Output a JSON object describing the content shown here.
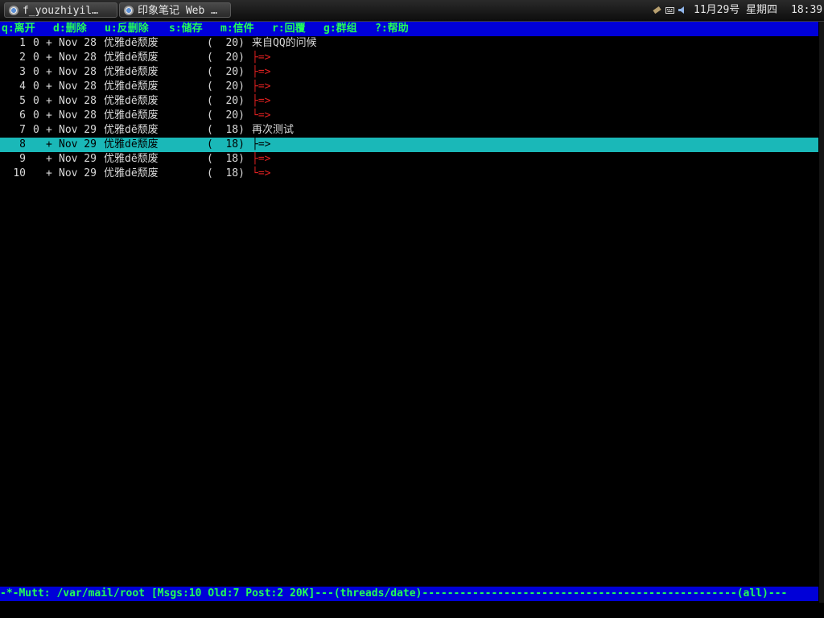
{
  "taskbar": {
    "tasks": [
      {
        "label": "f_youzhiyil…"
      },
      {
        "label": "印象笔记 Web …"
      }
    ],
    "date": "11月29号",
    "weekday": "星期四",
    "time": "18:39",
    "icons": [
      "network-icon",
      "keyboard-icon",
      "volume-icon"
    ]
  },
  "help": [
    {
      "key": "q:",
      "label": "离开"
    },
    {
      "key": "d:",
      "label": "删除"
    },
    {
      "key": "u:",
      "label": "反删除"
    },
    {
      "key": "s:",
      "label": "储存"
    },
    {
      "key": "m:",
      "label": "信件"
    },
    {
      "key": "r:",
      "label": "回覆"
    },
    {
      "key": "g:",
      "label": "群组"
    },
    {
      "key": "?:",
      "label": "帮助"
    }
  ],
  "messages": [
    {
      "num": "1",
      "flag": "0",
      "status": "+",
      "date": "Nov 28",
      "from": "优雅dē颓废",
      "size": "(  20)",
      "tree": "",
      "subject": "来自QQ的问候",
      "selected": false
    },
    {
      "num": "2",
      "flag": "0",
      "status": "+",
      "date": "Nov 28",
      "from": "优雅dē颓废",
      "size": "(  20)",
      "tree": "├=>",
      "subject": "",
      "selected": false
    },
    {
      "num": "3",
      "flag": "0",
      "status": "+",
      "date": "Nov 28",
      "from": "优雅dē颓废",
      "size": "(  20)",
      "tree": "├=>",
      "subject": "",
      "selected": false
    },
    {
      "num": "4",
      "flag": "0",
      "status": "+",
      "date": "Nov 28",
      "from": "优雅dē颓废",
      "size": "(  20)",
      "tree": "├=>",
      "subject": "",
      "selected": false
    },
    {
      "num": "5",
      "flag": "0",
      "status": "+",
      "date": "Nov 28",
      "from": "优雅dē颓废",
      "size": "(  20)",
      "tree": "├=>",
      "subject": "",
      "selected": false
    },
    {
      "num": "6",
      "flag": "0",
      "status": "+",
      "date": "Nov 28",
      "from": "优雅dē颓废",
      "size": "(  20)",
      "tree": "└=>",
      "subject": "",
      "selected": false
    },
    {
      "num": "7",
      "flag": "0",
      "status": "+",
      "date": "Nov 29",
      "from": "优雅dē颓废",
      "size": "(  18)",
      "tree": "",
      "subject": "再次测试",
      "selected": false
    },
    {
      "num": "8",
      "flag": "",
      "status": "+",
      "date": "Nov 29",
      "from": "优雅dē颓废",
      "size": "(  18)",
      "tree": "├=>",
      "subject": "",
      "selected": true
    },
    {
      "num": "9",
      "flag": "",
      "status": "+",
      "date": "Nov 29",
      "from": "优雅dē颓废",
      "size": "(  18)",
      "tree": "├=>",
      "subject": "",
      "selected": false
    },
    {
      "num": "10",
      "flag": "",
      "status": "+",
      "date": "Nov 29",
      "from": "优雅dē颓废",
      "size": "(  18)",
      "tree": "└=>",
      "subject": "",
      "selected": false
    }
  ],
  "status_line": "-*-Mutt: /var/mail/root [Msgs:10 Old:7 Post:2 20K]---(threads/date)--------------------------------------------------(all)---",
  "colors": {
    "help_bg": "#0000d8",
    "help_fg": "#22ff55",
    "selected_bg": "#1ab8b8",
    "tree": "#e02020"
  }
}
